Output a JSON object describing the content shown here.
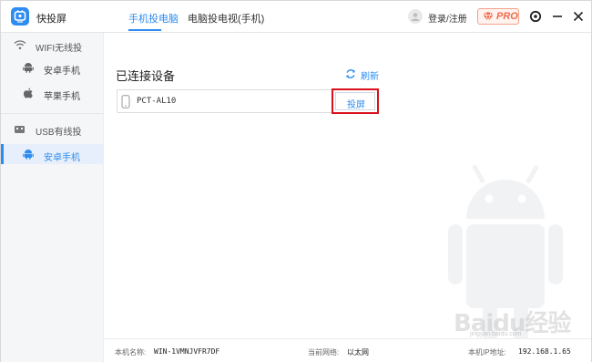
{
  "app": {
    "name": "快投屏",
    "icon": "tv-cast-icon"
  },
  "tabs": [
    {
      "label": "手机投电脑",
      "active": true
    },
    {
      "label": "电脑投电视(手机)",
      "active": false
    }
  ],
  "header": {
    "login_label": "登录/注册",
    "pro_label": "PRO",
    "icons": [
      "avatar-icon",
      "gem-icon",
      "settings-icon",
      "minimize-icon",
      "close-icon"
    ]
  },
  "sidebar": {
    "wifi_group": {
      "label": "WIFI无线投",
      "icon": "wifi-icon"
    },
    "wifi_items": [
      {
        "label": "安卓手机",
        "icon": "android-icon"
      },
      {
        "label": "苹果手机",
        "icon": "apple-icon"
      }
    ],
    "usb_group": {
      "label": "USB有线投",
      "icon": "usb-icon"
    },
    "usb_items": [
      {
        "label": "安卓手机",
        "icon": "android-icon",
        "active": true
      }
    ]
  },
  "main": {
    "title": "已连接设备",
    "refresh_label": "刷新",
    "device": {
      "name": "PCT-AL10",
      "action_label": "投屏"
    }
  },
  "status": {
    "pc_name_key": "本机名称:",
    "pc_name_value": "WIN-1VMNJVFR7DF",
    "network_key": "当前网络:",
    "network_value": "以太网",
    "ip_key": "本机IP地址:",
    "ip_value": "192.168.1.65"
  },
  "watermark": {
    "text": "Baidu经验",
    "sub": "jingyan.baidu.com"
  },
  "colors": {
    "accent": "#2d8cf0",
    "highlight": "#d9111b",
    "pro": "#ef6b4a"
  }
}
